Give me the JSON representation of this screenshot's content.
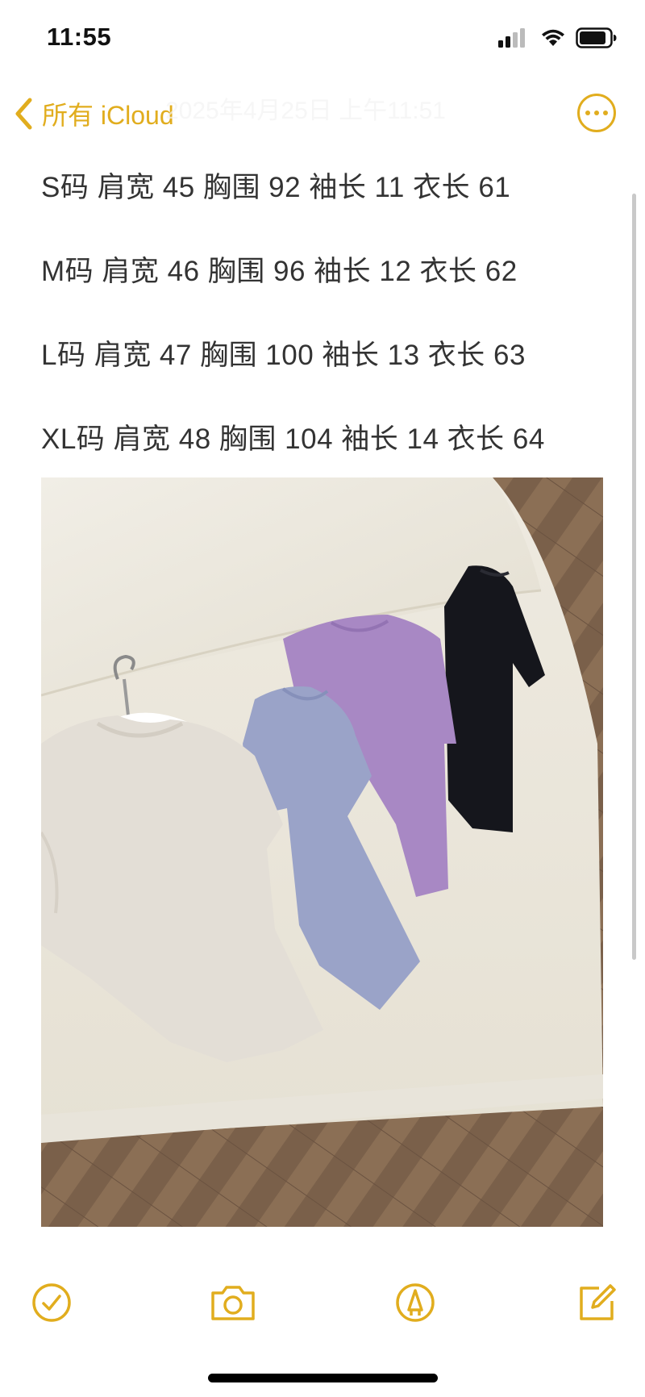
{
  "status_bar": {
    "time": "11:55"
  },
  "nav": {
    "back_label": "所有 iCloud",
    "faded_date": "2025年4月25日 上午11:51"
  },
  "note": {
    "lines": [
      "S码 肩宽 45 胸围 92 袖长 11 衣长 61",
      "M码 肩宽 46 胸围 96 袖长 12 衣长 62",
      "L码 肩宽 47 胸围 100 袖长 13 衣长 63",
      "XL码 肩宽 48 胸围 104 袖长 14 衣长 64"
    ]
  },
  "colors": {
    "accent": "#e1ad1e",
    "text": "#333333"
  },
  "icons": {
    "checklist": "checklist-icon",
    "camera": "camera-icon",
    "markup": "markup-pen-icon",
    "compose": "compose-icon",
    "more": "more-icon",
    "back": "chevron-left-icon"
  }
}
